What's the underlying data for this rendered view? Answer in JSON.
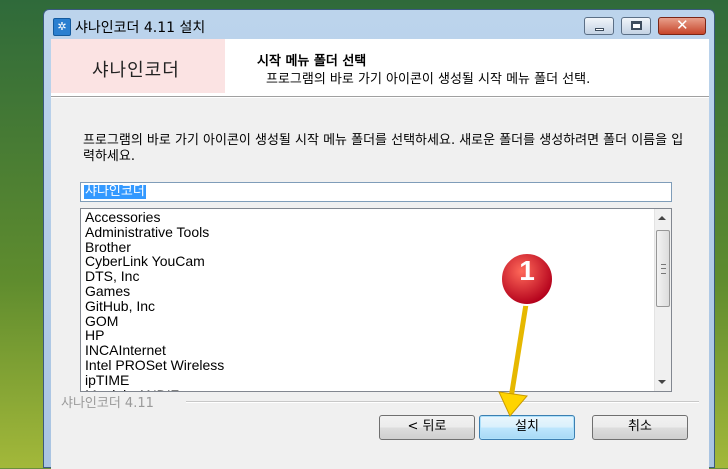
{
  "window": {
    "title": "샤나인코더 4.11 설치",
    "app_icon_glyph": "✲"
  },
  "header": {
    "logo_text": "샤나인코더",
    "title": "시작 메뉴 폴더 선택",
    "subtitle": "프로그램의 바로 가기 아이콘이 생성될 시작 메뉴 폴더 선택."
  },
  "body": {
    "instruction": "프로그램의 바로 가기 아이콘이 생성될 시작 메뉴 폴더를 선택하세요. 새로운 폴더를 생성하려면 폴더 이름을 입력하세요.",
    "folder_input_value": "샤나인코더",
    "folders": [
      "Accessories",
      "Administrative Tools",
      "Brother",
      "CyberLink YouCam",
      "DTS, Inc",
      "Games",
      "GitHub, Inc",
      "GOM",
      "HP",
      "INCAInternet",
      "Intel PROSet Wireless",
      "ipTIME",
      "Maniain ANDIZ"
    ]
  },
  "footer": {
    "brand": "샤나인코더 4.11",
    "back_label": "< 뒤로",
    "install_label": "설치",
    "cancel_label": "취소"
  },
  "annotation": {
    "badge_number": "1",
    "badge_color": "#c8102e",
    "arrow_color": "#ffd400"
  }
}
